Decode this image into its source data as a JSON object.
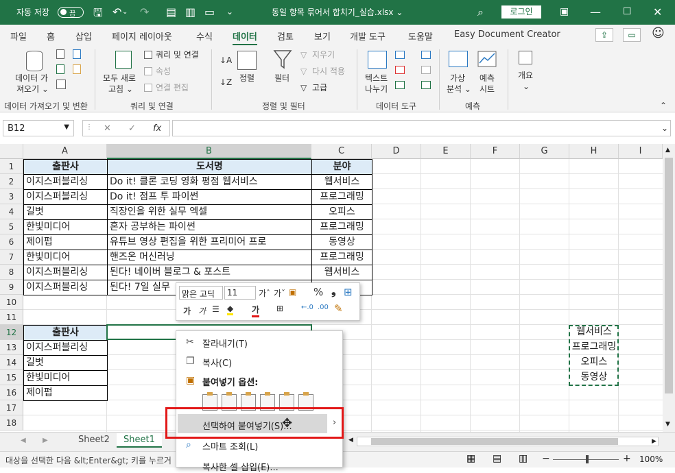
{
  "titlebar": {
    "autosave": "자동 저장",
    "toggle": "끔",
    "filename": "동일 항목 묶어서 합치기_실습.xlsx",
    "filename_caret": "⌄",
    "login": "로그인"
  },
  "tabs": [
    "파일",
    "홈",
    "삽입",
    "페이지 레이아웃",
    "수식",
    "데이터",
    "검토",
    "보기",
    "개발 도구",
    "도움말",
    "Easy Document Creator"
  ],
  "active_tab": "데이터",
  "ribbon": {
    "get_data": "데이터 가",
    "get_data2": "져오기 ⌄",
    "group1": "데이터 가져오기 및 변환",
    "refresh_all": "모두 새로",
    "refresh_all2": "고침 ⌄",
    "queries": "쿼리 및 연결",
    "properties": "속성",
    "edit_links": "연결 편집",
    "group2": "쿼리 및 연결",
    "sort": "정렬",
    "filter": "필터",
    "clear": "지우기",
    "reapply": "다시 적용",
    "advanced": "고급",
    "group3": "정렬 및 필터",
    "text_to_col": "텍스트",
    "text_to_col2": "나누기",
    "group4": "데이터 도구",
    "whatif": "가상",
    "whatif2": "분석 ⌄",
    "forecast": "예측",
    "forecast2": "시트",
    "group5": "예측",
    "outline": "개요",
    "outline2": "⌄"
  },
  "formula_bar": {
    "name_box": "B12",
    "fx": "fx",
    "cancel": "✕",
    "enter": "✓",
    "value": ""
  },
  "columns": [
    "A",
    "B",
    "C",
    "D",
    "E",
    "F",
    "G",
    "H",
    "I"
  ],
  "rows": [
    "1",
    "2",
    "3",
    "4",
    "5",
    "6",
    "7",
    "8",
    "9",
    "10",
    "11",
    "12",
    "13",
    "14",
    "15",
    "16",
    "17",
    "18"
  ],
  "table1": {
    "headers": [
      "출판사",
      "도서명",
      "분야"
    ],
    "rows": [
      [
        "이지스퍼블리싱",
        "Do it! 클론 코딩 영화 평점 웹서비스",
        "웹서비스"
      ],
      [
        "이지스퍼블리싱",
        "Do it! 점프 투 파이썬",
        "프로그래밍"
      ],
      [
        "길벗",
        "직장인을 위한 실무 엑셀",
        "오피스"
      ],
      [
        "한빛미디어",
        "혼자 공부하는 파이썬",
        "프로그래밍"
      ],
      [
        "제이펍",
        "유튜브 영상 편집을 위한 프리미어 프로",
        "동영상"
      ],
      [
        "한빛미디어",
        "핸즈온 머신러닝",
        "프로그래밍"
      ],
      [
        "이지스퍼블리싱",
        "된다! 네이버 블로그 & 포스트",
        "웹서비스"
      ],
      [
        "이지스퍼블리싱",
        "된다! 7일 실무",
        ""
      ]
    ]
  },
  "table2": {
    "header": "출판사",
    "rows": [
      "이지스퍼블리싱",
      "길벗",
      "한빛미디어",
      "제이펍"
    ]
  },
  "copied": [
    "웹서비스",
    "프로그래밍",
    "오피스",
    "동영상"
  ],
  "mini_toolbar": {
    "font": "맑은 고딕",
    "size": "11",
    "bold": "가",
    "italic": "가",
    "percent": "%",
    "comma": "❟"
  },
  "context_menu": {
    "cut": "잘라내기(T)",
    "copy": "복사(C)",
    "paste_options": "붙여넣기 옵션:",
    "paste_special": "선택하여 붙여넣기(S)...",
    "smart_lookup": "스마트 조회(L)",
    "insert_copied": "복사한 셀 삽입(E)..."
  },
  "sheets": [
    "Sheet2",
    "Sheet1"
  ],
  "active_sheet": "Sheet1",
  "status": {
    "message": "대상을 선택한 다음 &lt;Enter&gt; 키를 누르거",
    "zoom": "100%"
  },
  "colors": {
    "excel_green": "#217346",
    "header_fill": "#ddebf7",
    "highlight": "#e21818"
  }
}
